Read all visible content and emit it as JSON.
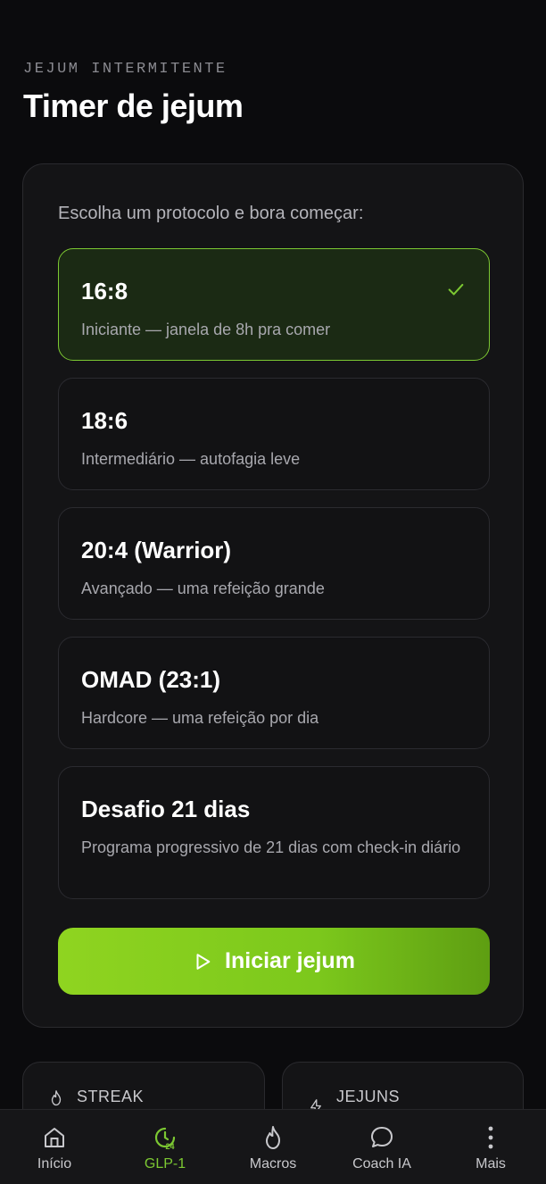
{
  "header": {
    "eyebrow": "JEJUM INTERMITENTE",
    "title": "Timer de jejum"
  },
  "protocol_card": {
    "prompt": "Escolha um protocolo e bora começar:",
    "options": [
      {
        "name": "16:8",
        "description": "Iniciante — janela de 8h pra comer",
        "selected": true
      },
      {
        "name": "18:6",
        "description": "Intermediário — autofagia leve",
        "selected": false
      },
      {
        "name": "20:4 (Warrior)",
        "description": "Avançado — uma refeição grande",
        "selected": false
      },
      {
        "name": "OMAD (23:1)",
        "description": "Hardcore — uma refeição por dia",
        "selected": false
      },
      {
        "name": "Desafio 21 dias",
        "description": "Programa progressivo de 21 dias com check-in diário",
        "selected": false
      }
    ],
    "start_button_label": "Iniciar jejum",
    "start_button_icon": "play-icon"
  },
  "stats": [
    {
      "label": "STREAK",
      "icon": "flame-icon"
    },
    {
      "label": "JEJUNS",
      "icon": "bolt-icon"
    }
  ],
  "bottom_nav": [
    {
      "label": "Início",
      "icon": "home-icon",
      "active": false
    },
    {
      "label": "GLP-1",
      "icon": "timer-24-icon",
      "active": true
    },
    {
      "label": "Macros",
      "icon": "flame-icon",
      "active": false
    },
    {
      "label": "Coach IA",
      "icon": "chat-bubble-icon",
      "active": false
    },
    {
      "label": "Mais",
      "icon": "more-vertical-icon",
      "active": false
    }
  ],
  "colors": {
    "background": "#0b0b0d",
    "card": "#141416",
    "accent": "#7cc832",
    "selected_bg": "#1b2a14"
  }
}
